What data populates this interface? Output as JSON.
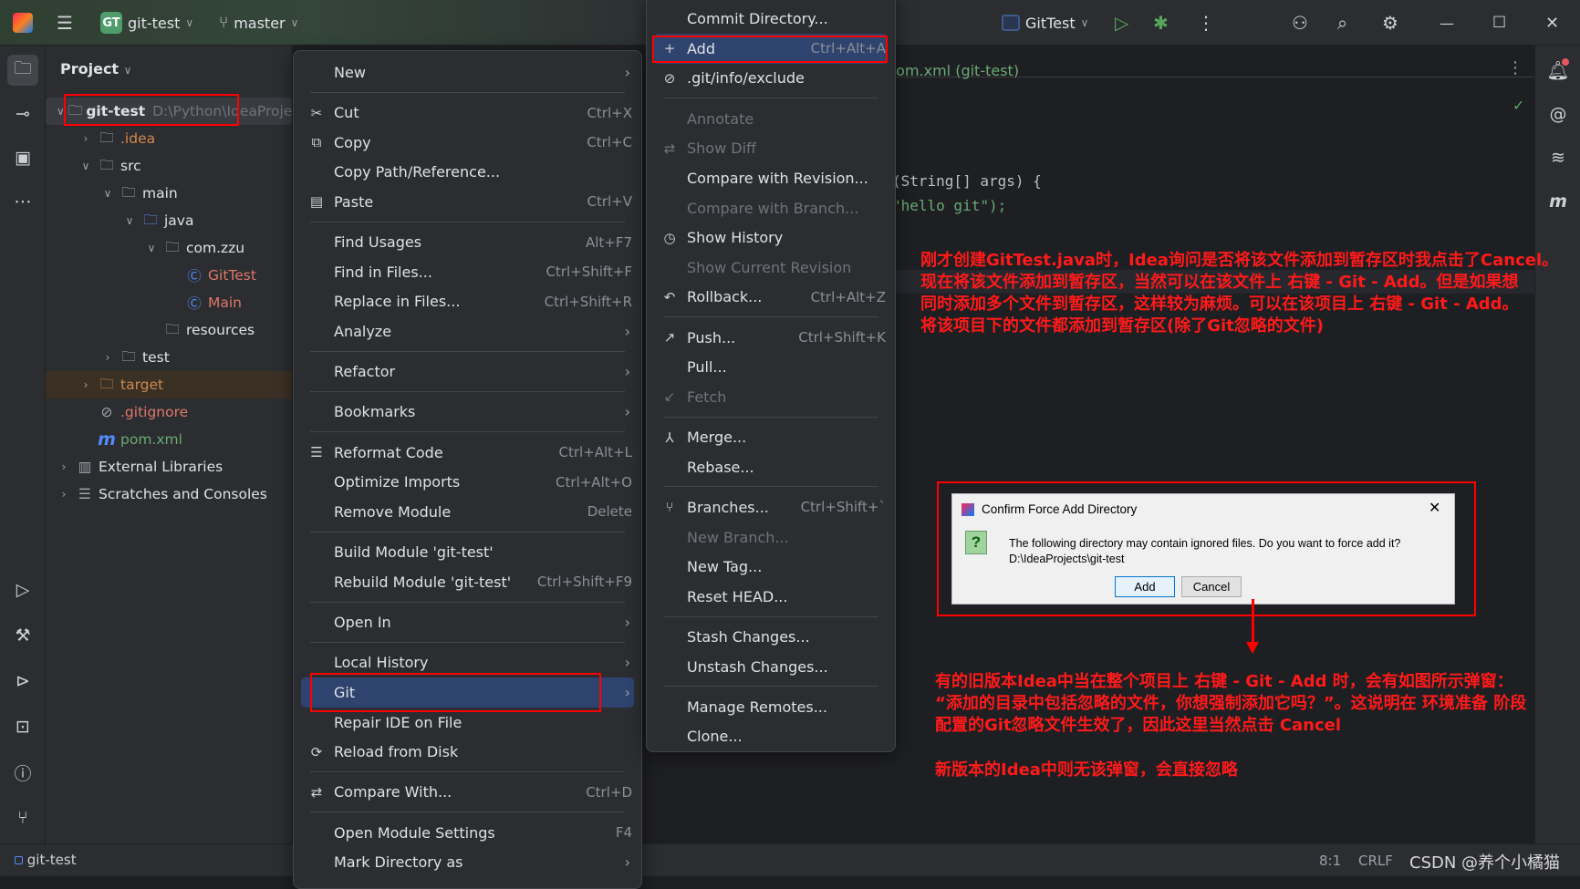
{
  "titlebar": {
    "project_badge": "GT",
    "project": "git-test",
    "branch": "master",
    "run_config": "GitTest"
  },
  "project_panel": {
    "title": "Project",
    "tree": [
      {
        "label": "git-test",
        "hint": "D:\\Python\\IdeaProje",
        "level": 0,
        "expanded": true,
        "icon": "module-folder-icon",
        "color": "#dfe1e5",
        "bold": true
      },
      {
        "label": ".idea",
        "level": 1,
        "expanded": false,
        "icon": "folder-icon",
        "color": "#d4884f"
      },
      {
        "label": "src",
        "level": 1,
        "expanded": true,
        "icon": "folder-icon",
        "color": "#dfe1e5"
      },
      {
        "label": "main",
        "level": 2,
        "expanded": true,
        "icon": "folder-icon",
        "color": "#dfe1e5"
      },
      {
        "label": "java",
        "level": 3,
        "expanded": true,
        "icon": "source-folder-icon",
        "color": "#dfe1e5"
      },
      {
        "label": "com.zzu",
        "level": 4,
        "expanded": true,
        "icon": "package-icon",
        "color": "#dfe1e5"
      },
      {
        "label": "GitTest",
        "level": 5,
        "icon": "java-class-icon",
        "color": "#e0776a"
      },
      {
        "label": "Main",
        "level": 5,
        "icon": "java-class-icon",
        "color": "#e0776a"
      },
      {
        "label": "resources",
        "level": 4,
        "icon": "resources-folder-icon",
        "color": "#dfe1e5"
      },
      {
        "label": "test",
        "level": 2,
        "expanded": false,
        "icon": "folder-icon",
        "color": "#dfe1e5"
      },
      {
        "label": "target",
        "level": 1,
        "expanded": false,
        "icon": "excluded-folder-icon",
        "color": "#c98a55",
        "highlight": true
      },
      {
        "label": ".gitignore",
        "level": 1,
        "icon": "ignore-file-icon",
        "color": "#e0776a"
      },
      {
        "label": "pom.xml",
        "level": 1,
        "icon": "maven-icon",
        "color": "#6aab73"
      },
      {
        "label": "External Libraries",
        "level": 0,
        "expanded": false,
        "icon": "library-icon",
        "color": "#dfe1e5"
      },
      {
        "label": "Scratches and Consoles",
        "level": 0,
        "expanded": false,
        "icon": "scratches-icon",
        "color": "#dfe1e5"
      }
    ]
  },
  "editor": {
    "tab": "pom.xml (git-test)",
    "code": [
      "(String[] args) {",
      "\"hello git\");"
    ]
  },
  "context_menu": [
    {
      "label": "New",
      "submenu": true
    },
    {
      "sep": true
    },
    {
      "label": "Cut",
      "shortcut": "Ctrl+X",
      "icon": "✂",
      "iconname": "scissors-icon"
    },
    {
      "label": "Copy",
      "shortcut": "Ctrl+C",
      "icon": "⧉",
      "iconname": "copy-icon"
    },
    {
      "label": "Copy Path/Reference..."
    },
    {
      "label": "Paste",
      "shortcut": "Ctrl+V",
      "icon": "▤",
      "iconname": "paste-icon"
    },
    {
      "sep": true
    },
    {
      "label": "Find Usages",
      "shortcut": "Alt+F7"
    },
    {
      "label": "Find in Files...",
      "shortcut": "Ctrl+Shift+F"
    },
    {
      "label": "Replace in Files...",
      "shortcut": "Ctrl+Shift+R"
    },
    {
      "label": "Analyze",
      "submenu": true
    },
    {
      "sep": true
    },
    {
      "label": "Refactor",
      "submenu": true
    },
    {
      "sep": true
    },
    {
      "label": "Bookmarks",
      "submenu": true
    },
    {
      "sep": true
    },
    {
      "label": "Reformat Code",
      "shortcut": "Ctrl+Alt+L",
      "icon": "☰",
      "iconname": "reformat-icon"
    },
    {
      "label": "Optimize Imports",
      "shortcut": "Ctrl+Alt+O"
    },
    {
      "label": "Remove Module",
      "shortcut": "Delete"
    },
    {
      "sep": true
    },
    {
      "label": "Build Module 'git-test'"
    },
    {
      "label": "Rebuild Module 'git-test'",
      "shortcut": "Ctrl+Shift+F9"
    },
    {
      "sep": true
    },
    {
      "label": "Open In",
      "submenu": true
    },
    {
      "sep": true
    },
    {
      "label": "Local History",
      "submenu": true
    },
    {
      "label": "Git",
      "submenu": true,
      "selected": true
    },
    {
      "label": "Repair IDE on File"
    },
    {
      "label": "Reload from Disk",
      "icon": "⟳",
      "iconname": "reload-icon"
    },
    {
      "sep": true
    },
    {
      "label": "Compare With...",
      "shortcut": "Ctrl+D",
      "icon": "⇄",
      "iconname": "compare-icon"
    },
    {
      "sep": true
    },
    {
      "label": "Open Module Settings",
      "shortcut": "F4"
    },
    {
      "label": "Mark Directory as",
      "submenu": true
    }
  ],
  "git_submenu": [
    {
      "label": "Commit Directory..."
    },
    {
      "label": "Add",
      "shortcut": "Ctrl+Alt+A",
      "icon": "+",
      "iconname": "plus-icon",
      "selected": true
    },
    {
      "label": ".git/info/exclude",
      "icon": "⊘",
      "iconname": "ignore-icon"
    },
    {
      "sep": true
    },
    {
      "label": "Annotate",
      "disabled": true
    },
    {
      "label": "Show Diff",
      "disabled": true,
      "icon": "⇄",
      "iconname": "diff-icon"
    },
    {
      "label": "Compare with Revision..."
    },
    {
      "label": "Compare with Branch...",
      "disabled": true
    },
    {
      "label": "Show History",
      "icon": "◷",
      "iconname": "history-icon"
    },
    {
      "label": "Show Current Revision",
      "disabled": true
    },
    {
      "label": "Rollback...",
      "shortcut": "Ctrl+Alt+Z",
      "icon": "↶",
      "iconname": "rollback-icon"
    },
    {
      "sep": true
    },
    {
      "label": "Push...",
      "shortcut": "Ctrl+Shift+K",
      "icon": "↗",
      "iconname": "push-icon"
    },
    {
      "label": "Pull..."
    },
    {
      "label": "Fetch",
      "disabled": true,
      "icon": "↙",
      "iconname": "fetch-icon"
    },
    {
      "sep": true
    },
    {
      "label": "Merge...",
      "icon": "⅄",
      "iconname": "merge-icon"
    },
    {
      "label": "Rebase..."
    },
    {
      "sep": true
    },
    {
      "label": "Branches...",
      "shortcut": "Ctrl+Shift+`",
      "icon": "⑂",
      "iconname": "branch-icon"
    },
    {
      "label": "New Branch...",
      "disabled": true
    },
    {
      "label": "New Tag..."
    },
    {
      "label": "Reset HEAD..."
    },
    {
      "sep": true
    },
    {
      "label": "Stash Changes..."
    },
    {
      "label": "Unstash Changes..."
    },
    {
      "sep": true
    },
    {
      "label": "Manage Remotes..."
    },
    {
      "label": "Clone..."
    }
  ],
  "annotations": {
    "note1": [
      "刚才创建GitTest.java时，Idea询问是否将该文件添加到暂存区时我点击了Cancel。",
      "现在将该文件添加到暂存区，当然可以在该文件上 右键 - Git - Add。但是如果想",
      "同时添加多个文件到暂存区，这样较为麻烦。可以在该项目上 右键 - Git - Add。",
      "将该项目下的文件都添加到暂存区(除了Git忽略的文件)"
    ],
    "note2": [
      "有的旧版本Idea中当在整个项目上 右键 - Git - Add 时，会有如图所示弹窗：",
      "“添加的目录中包括忽略的文件，你想强制添加它吗？”。这说明在 环境准备 阶段",
      "配置的Git忽略文件生效了，因此这里当然点击 Cancel"
    ],
    "note3": "新版本的Idea中则无该弹窗，会直接忽略",
    "color": "#ff0000"
  },
  "dialog": {
    "title": "Confirm Force Add Directory",
    "message": "The following directory may contain ignored files. Do you want to force add it?",
    "path": "D:\\IdeaProjects\\git-test",
    "add": "Add",
    "cancel": "Cancel"
  },
  "status": {
    "project": "git-test",
    "position": "8:1",
    "line_sep": "CRLF",
    "watermark": "CSDN @养个小橘猫"
  }
}
